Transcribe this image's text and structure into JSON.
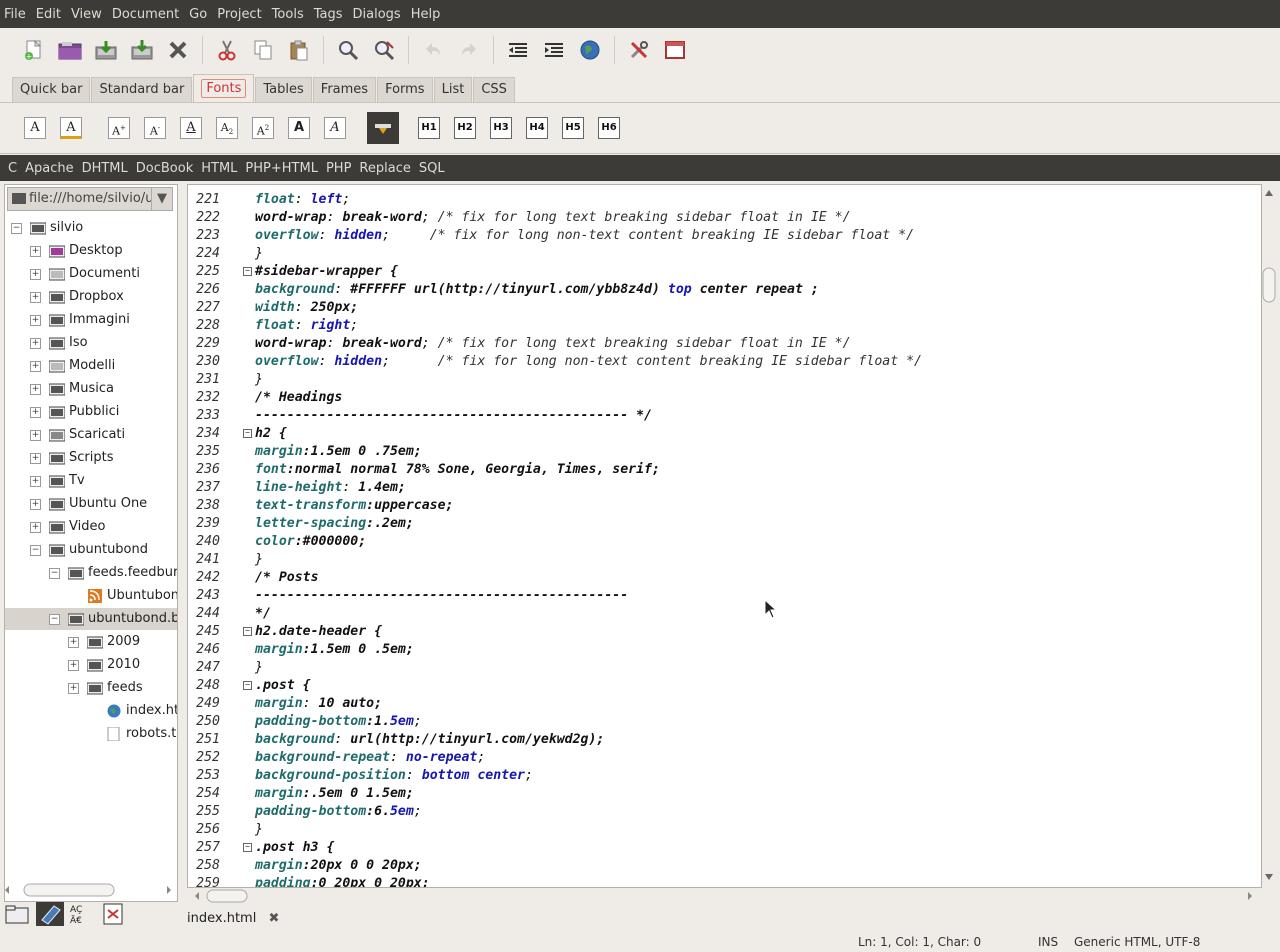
{
  "menubar": {
    "items": [
      "File",
      "Edit",
      "View",
      "Document",
      "Go",
      "Project",
      "Tools",
      "Tags",
      "Dialogs",
      "Help"
    ]
  },
  "toolbar": {
    "icons": [
      "new-file-icon",
      "open-file-icon",
      "save-icon",
      "save-all-icon",
      "close-icon",
      "cut-icon",
      "copy-icon",
      "paste-icon",
      "find-icon",
      "replace-icon",
      "undo-icon",
      "redo-icon",
      "unindent-icon",
      "indent-icon",
      "preview-browser-icon",
      "preferences-icon",
      "fullscreen-icon"
    ]
  },
  "tabs": {
    "items": [
      "Quick bar",
      "Standard bar",
      "Fonts",
      "Tables",
      "Frames",
      "Forms",
      "List",
      "CSS"
    ],
    "active": "Fonts"
  },
  "fontbar": {
    "headings": [
      "H1",
      "H2",
      "H3",
      "H4",
      "H5",
      "H6"
    ],
    "glyphs": {
      "big": "A",
      "bold": "A",
      "italic": "A"
    }
  },
  "snippets": {
    "items": [
      "C",
      "Apache",
      "DHTML",
      "DocBook",
      "HTML",
      "PHP+HTML",
      "PHP",
      "Replace",
      "SQL"
    ]
  },
  "sidebar": {
    "path": "file:///home/silvio/ubuntubond",
    "tree": [
      {
        "label": "silvio",
        "depth": 0,
        "exp": "-",
        "icon": "folder"
      },
      {
        "label": "Desktop",
        "depth": 1,
        "exp": "+",
        "icon": "desktop"
      },
      {
        "label": "Documenti",
        "depth": 1,
        "exp": "+",
        "icon": "documents"
      },
      {
        "label": "Dropbox",
        "depth": 1,
        "exp": "+",
        "icon": "folder"
      },
      {
        "label": "Immagini",
        "depth": 1,
        "exp": "+",
        "icon": "pictures"
      },
      {
        "label": "Iso",
        "depth": 1,
        "exp": "+",
        "icon": "folder"
      },
      {
        "label": "Modelli",
        "depth": 1,
        "exp": "+",
        "icon": "templates"
      },
      {
        "label": "Musica",
        "depth": 1,
        "exp": "+",
        "icon": "music"
      },
      {
        "label": "Pubblici",
        "depth": 1,
        "exp": "+",
        "icon": "public"
      },
      {
        "label": "Scaricati",
        "depth": 1,
        "exp": "+",
        "icon": "downloads"
      },
      {
        "label": "Scripts",
        "depth": 1,
        "exp": "+",
        "icon": "folder"
      },
      {
        "label": "Tv",
        "depth": 1,
        "exp": "+",
        "icon": "folder"
      },
      {
        "label": "Ubuntu One",
        "depth": 1,
        "exp": "+",
        "icon": "folder"
      },
      {
        "label": "Video",
        "depth": 1,
        "exp": "+",
        "icon": "video"
      },
      {
        "label": "ubuntubond",
        "depth": 1,
        "exp": "-",
        "icon": "folder"
      },
      {
        "label": "feeds.feedburner",
        "depth": 2,
        "exp": "-",
        "icon": "folder"
      },
      {
        "label": "Ubuntubond",
        "depth": 3,
        "exp": "",
        "icon": "rss"
      },
      {
        "label": "ubuntubond.blogspot",
        "depth": 2,
        "exp": "-",
        "icon": "folder",
        "selected": true
      },
      {
        "label": "2009",
        "depth": 3,
        "exp": "+",
        "icon": "folder"
      },
      {
        "label": "2010",
        "depth": 3,
        "exp": "+",
        "icon": "folder"
      },
      {
        "label": "feeds",
        "depth": 3,
        "exp": "+",
        "icon": "folder"
      },
      {
        "label": "index.html",
        "depth": 4,
        "exp": "",
        "icon": "globe"
      },
      {
        "label": "robots.txt",
        "depth": 4,
        "exp": "",
        "icon": "text"
      }
    ]
  },
  "editor": {
    "top_fragment": "",
    "lines": [
      {
        "n": "221",
        "fold": "",
        "t": [
          [
            "p",
            "float"
          ],
          [
            "c",
            ": "
          ],
          [
            "v",
            "left"
          ],
          [
            "c",
            ";"
          ]
        ]
      },
      {
        "n": "222",
        "fold": "",
        "t": [
          [
            "s",
            "word-wrap"
          ],
          [
            "c",
            ": "
          ],
          [
            "s",
            "break-word"
          ],
          [
            "c",
            "; "
          ],
          [
            "m",
            "/* fix for long text breaking sidebar float in IE */"
          ]
        ]
      },
      {
        "n": "223",
        "fold": "",
        "t": [
          [
            "p",
            "overflow"
          ],
          [
            "c",
            ": "
          ],
          [
            "v",
            "hidden"
          ],
          [
            "c",
            ";     "
          ],
          [
            "m",
            "/* fix for long non-text content breaking IE sidebar float */"
          ]
        ]
      },
      {
        "n": "224",
        "fold": "",
        "t": [
          [
            "c",
            "}"
          ]
        ]
      },
      {
        "n": "225",
        "fold": "-",
        "t": [
          [
            "s",
            "#sidebar-wrapper {"
          ]
        ]
      },
      {
        "n": "226",
        "fold": "",
        "t": [
          [
            "p",
            "background"
          ],
          [
            "c",
            ": "
          ],
          [
            "s",
            "#FFFFFF url(http://tinyurl.com/ybb8z4d) "
          ],
          [
            "v",
            "top"
          ],
          [
            "c",
            " "
          ],
          [
            "s",
            "center repeat ;"
          ]
        ]
      },
      {
        "n": "227",
        "fold": "",
        "t": [
          [
            "p",
            "width"
          ],
          [
            "c",
            ": "
          ],
          [
            "s",
            "250px;"
          ]
        ]
      },
      {
        "n": "228",
        "fold": "",
        "t": [
          [
            "p",
            "float"
          ],
          [
            "c",
            ": "
          ],
          [
            "v",
            "right"
          ],
          [
            "c",
            ";"
          ]
        ]
      },
      {
        "n": "229",
        "fold": "",
        "t": [
          [
            "s",
            "word-wrap"
          ],
          [
            "c",
            ": "
          ],
          [
            "s",
            "break-word"
          ],
          [
            "c",
            "; "
          ],
          [
            "m",
            "/* fix for long text breaking sidebar float in IE */"
          ]
        ]
      },
      {
        "n": "230",
        "fold": "",
        "t": [
          [
            "p",
            "overflow"
          ],
          [
            "c",
            ": "
          ],
          [
            "v",
            "hidden"
          ],
          [
            "c",
            ";      "
          ],
          [
            "m",
            "/* fix for long non-text content breaking IE sidebar float */"
          ]
        ]
      },
      {
        "n": "231",
        "fold": "",
        "t": [
          [
            "c",
            "}"
          ]
        ]
      },
      {
        "n": "232",
        "fold": "",
        "t": [
          [
            "s",
            "/* Headings"
          ]
        ]
      },
      {
        "n": "233",
        "fold": "",
        "t": [
          [
            "s",
            "----------------------------------------------- */"
          ]
        ]
      },
      {
        "n": "234",
        "fold": "-",
        "t": [
          [
            "s",
            "h2 {"
          ]
        ]
      },
      {
        "n": "235",
        "fold": "",
        "t": [
          [
            "p",
            "margin"
          ],
          [
            "s",
            ":1.5em 0 .75em;"
          ]
        ]
      },
      {
        "n": "236",
        "fold": "",
        "t": [
          [
            "p",
            "font"
          ],
          [
            "s",
            ":normal normal 78% Sone, Georgia, Times, serif;"
          ]
        ]
      },
      {
        "n": "237",
        "fold": "",
        "t": [
          [
            "p",
            "line-height"
          ],
          [
            "c",
            ": "
          ],
          [
            "s",
            "1.4em;"
          ]
        ]
      },
      {
        "n": "238",
        "fold": "",
        "t": [
          [
            "p",
            "text-transform"
          ],
          [
            "s",
            ":uppercase;"
          ]
        ]
      },
      {
        "n": "239",
        "fold": "",
        "t": [
          [
            "p",
            "letter-spacing"
          ],
          [
            "s",
            ":.2em;"
          ]
        ]
      },
      {
        "n": "240",
        "fold": "",
        "t": [
          [
            "p",
            "color"
          ],
          [
            "s",
            ":#000000;"
          ]
        ]
      },
      {
        "n": "241",
        "fold": "",
        "t": [
          [
            "c",
            "}"
          ]
        ]
      },
      {
        "n": "242",
        "fold": "",
        "t": [
          [
            "s",
            "/* Posts"
          ]
        ]
      },
      {
        "n": "243",
        "fold": "",
        "t": [
          [
            "s",
            "-----------------------------------------------"
          ]
        ]
      },
      {
        "n": "244",
        "fold": "",
        "t": [
          [
            "s",
            "*/"
          ]
        ]
      },
      {
        "n": "245",
        "fold": "-",
        "t": [
          [
            "s",
            "h2.date-header {"
          ]
        ]
      },
      {
        "n": "246",
        "fold": "",
        "t": [
          [
            "p",
            "margin"
          ],
          [
            "s",
            ":1.5em 0 .5em;"
          ]
        ]
      },
      {
        "n": "247",
        "fold": "",
        "t": [
          [
            "c",
            "}"
          ]
        ]
      },
      {
        "n": "248",
        "fold": "-",
        "t": [
          [
            "s",
            ".post {"
          ]
        ]
      },
      {
        "n": "249",
        "fold": "",
        "t": [
          [
            "p",
            "margin"
          ],
          [
            "c",
            ": "
          ],
          [
            "s",
            "10 auto;"
          ]
        ]
      },
      {
        "n": "250",
        "fold": "",
        "t": [
          [
            "p",
            "padding-bottom"
          ],
          [
            "s",
            ":1."
          ],
          [
            "v",
            "5em"
          ],
          [
            "c",
            ";"
          ]
        ]
      },
      {
        "n": "251",
        "fold": "",
        "t": [
          [
            "p",
            "background"
          ],
          [
            "c",
            ": "
          ],
          [
            "s",
            "url(http://tinyurl.com/yekwd2g);"
          ]
        ]
      },
      {
        "n": "252",
        "fold": "",
        "t": [
          [
            "p",
            "background-repeat"
          ],
          [
            "c",
            ": "
          ],
          [
            "v",
            "no-repeat"
          ],
          [
            "c",
            ";"
          ]
        ]
      },
      {
        "n": "253",
        "fold": "",
        "t": [
          [
            "p",
            "background-position"
          ],
          [
            "c",
            ": "
          ],
          [
            "v",
            "bottom center"
          ],
          [
            "c",
            ";"
          ]
        ]
      },
      {
        "n": "254",
        "fold": "",
        "t": [
          [
            "p",
            "margin"
          ],
          [
            "s",
            ":.5em 0 1.5em;"
          ]
        ]
      },
      {
        "n": "255",
        "fold": "",
        "t": [
          [
            "p",
            "padding-bottom"
          ],
          [
            "s",
            ":6."
          ],
          [
            "v",
            "5em"
          ],
          [
            "c",
            ";"
          ]
        ]
      },
      {
        "n": "256",
        "fold": "",
        "t": [
          [
            "c",
            "}"
          ]
        ]
      },
      {
        "n": "257",
        "fold": "-",
        "t": [
          [
            "s",
            ".post h3 {"
          ]
        ]
      },
      {
        "n": "258",
        "fold": "",
        "t": [
          [
            "p",
            "margin"
          ],
          [
            "s",
            ":20px 0 0 20px;"
          ]
        ]
      },
      {
        "n": "259",
        "fold": "",
        "t": [
          [
            "p",
            "padding"
          ],
          [
            "s",
            ":0 20px 0 20px;"
          ]
        ]
      }
    ]
  },
  "document_tab": {
    "label": "index.html"
  },
  "statusbar": {
    "position": "Ln: 1, Col: 1, Char: 0",
    "mode": "INS",
    "doc_type": "Generic HTML, UTF-8"
  },
  "bottom_icons": [
    "filebrowser-icon",
    "bookmarks-icon",
    "charmap-icon",
    "snippets-icon"
  ]
}
